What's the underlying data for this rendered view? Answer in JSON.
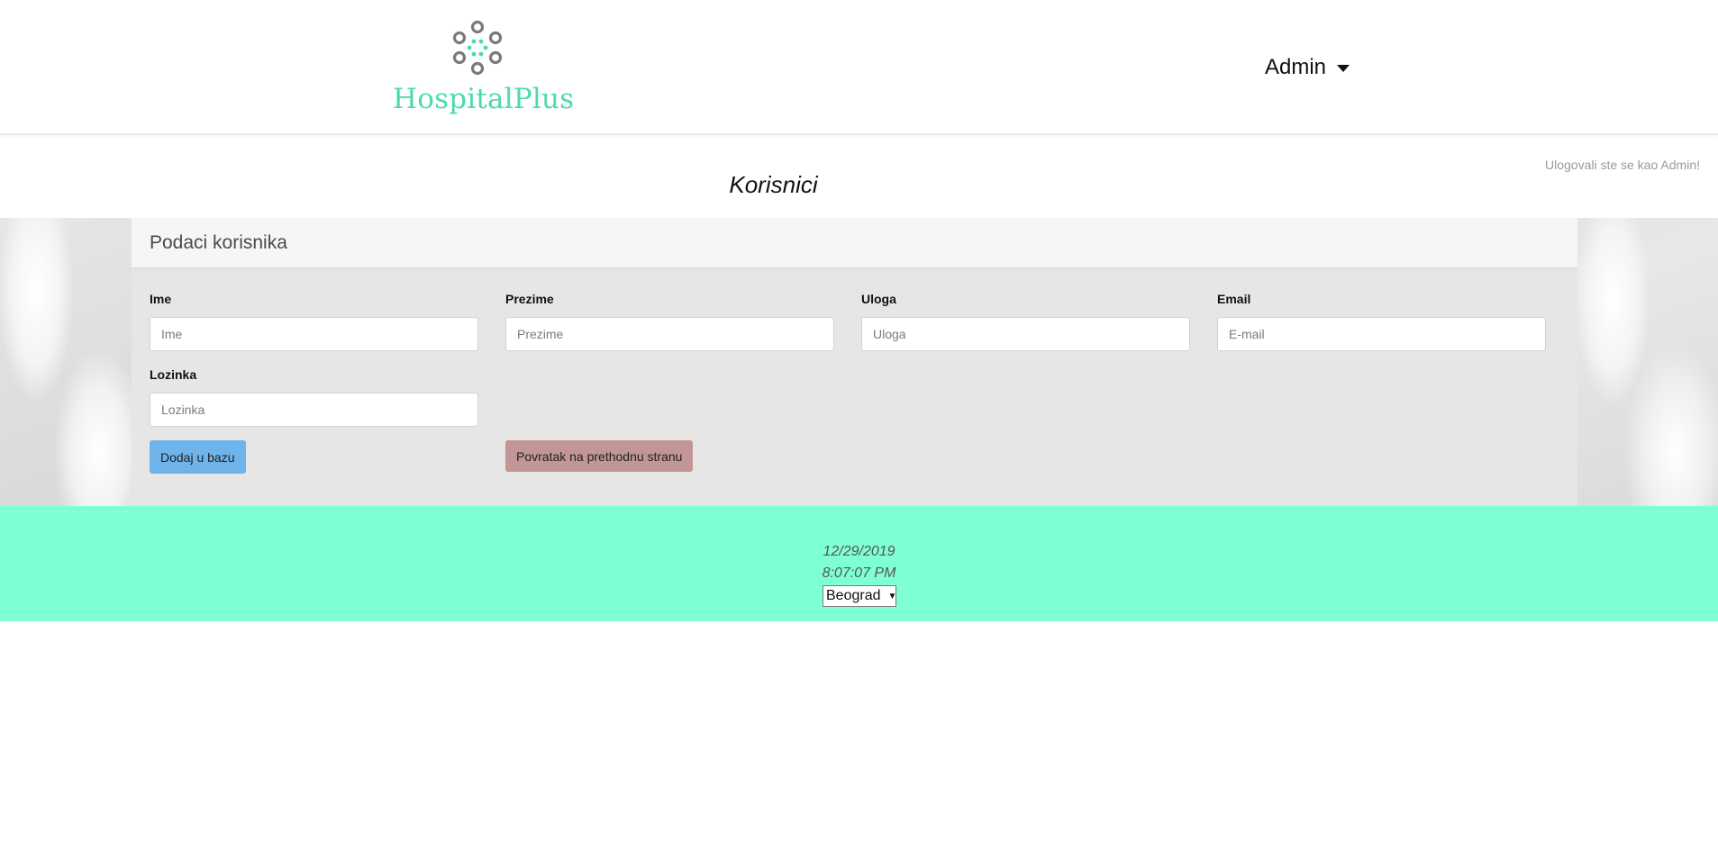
{
  "header": {
    "logo_text": "HospitalPlus",
    "user_menu_label": "Admin"
  },
  "status_text": "Ulogovali ste se kao Admin!",
  "page_title": "Korisnici",
  "card": {
    "title": "Podaci korisnika",
    "fields": {
      "ime": {
        "label": "Ime",
        "placeholder": "Ime",
        "value": ""
      },
      "prezime": {
        "label": "Prezime",
        "placeholder": "Prezime",
        "value": ""
      },
      "uloga": {
        "label": "Uloga",
        "placeholder": "Uloga",
        "value": ""
      },
      "email": {
        "label": "Email",
        "placeholder": "E-mail",
        "value": ""
      },
      "lozinka": {
        "label": "Lozinka",
        "placeholder": "Lozinka",
        "value": ""
      }
    },
    "add_button": "Dodaj u bazu",
    "back_button": "Povratak na prethodnu stranu"
  },
  "footer": {
    "date": "12/29/2019",
    "time": "8:07:07 PM",
    "city_selected": "Beograd"
  },
  "colors": {
    "brand": "#4bdca6",
    "footer_bg": "#7fffd4",
    "add_button": "#6eb3ea",
    "back_button": "#c29696"
  },
  "icons": {
    "logo": "hospitalplus-logo-icon",
    "user_menu": "caret-down-icon",
    "select": "select-arrow-icon"
  }
}
